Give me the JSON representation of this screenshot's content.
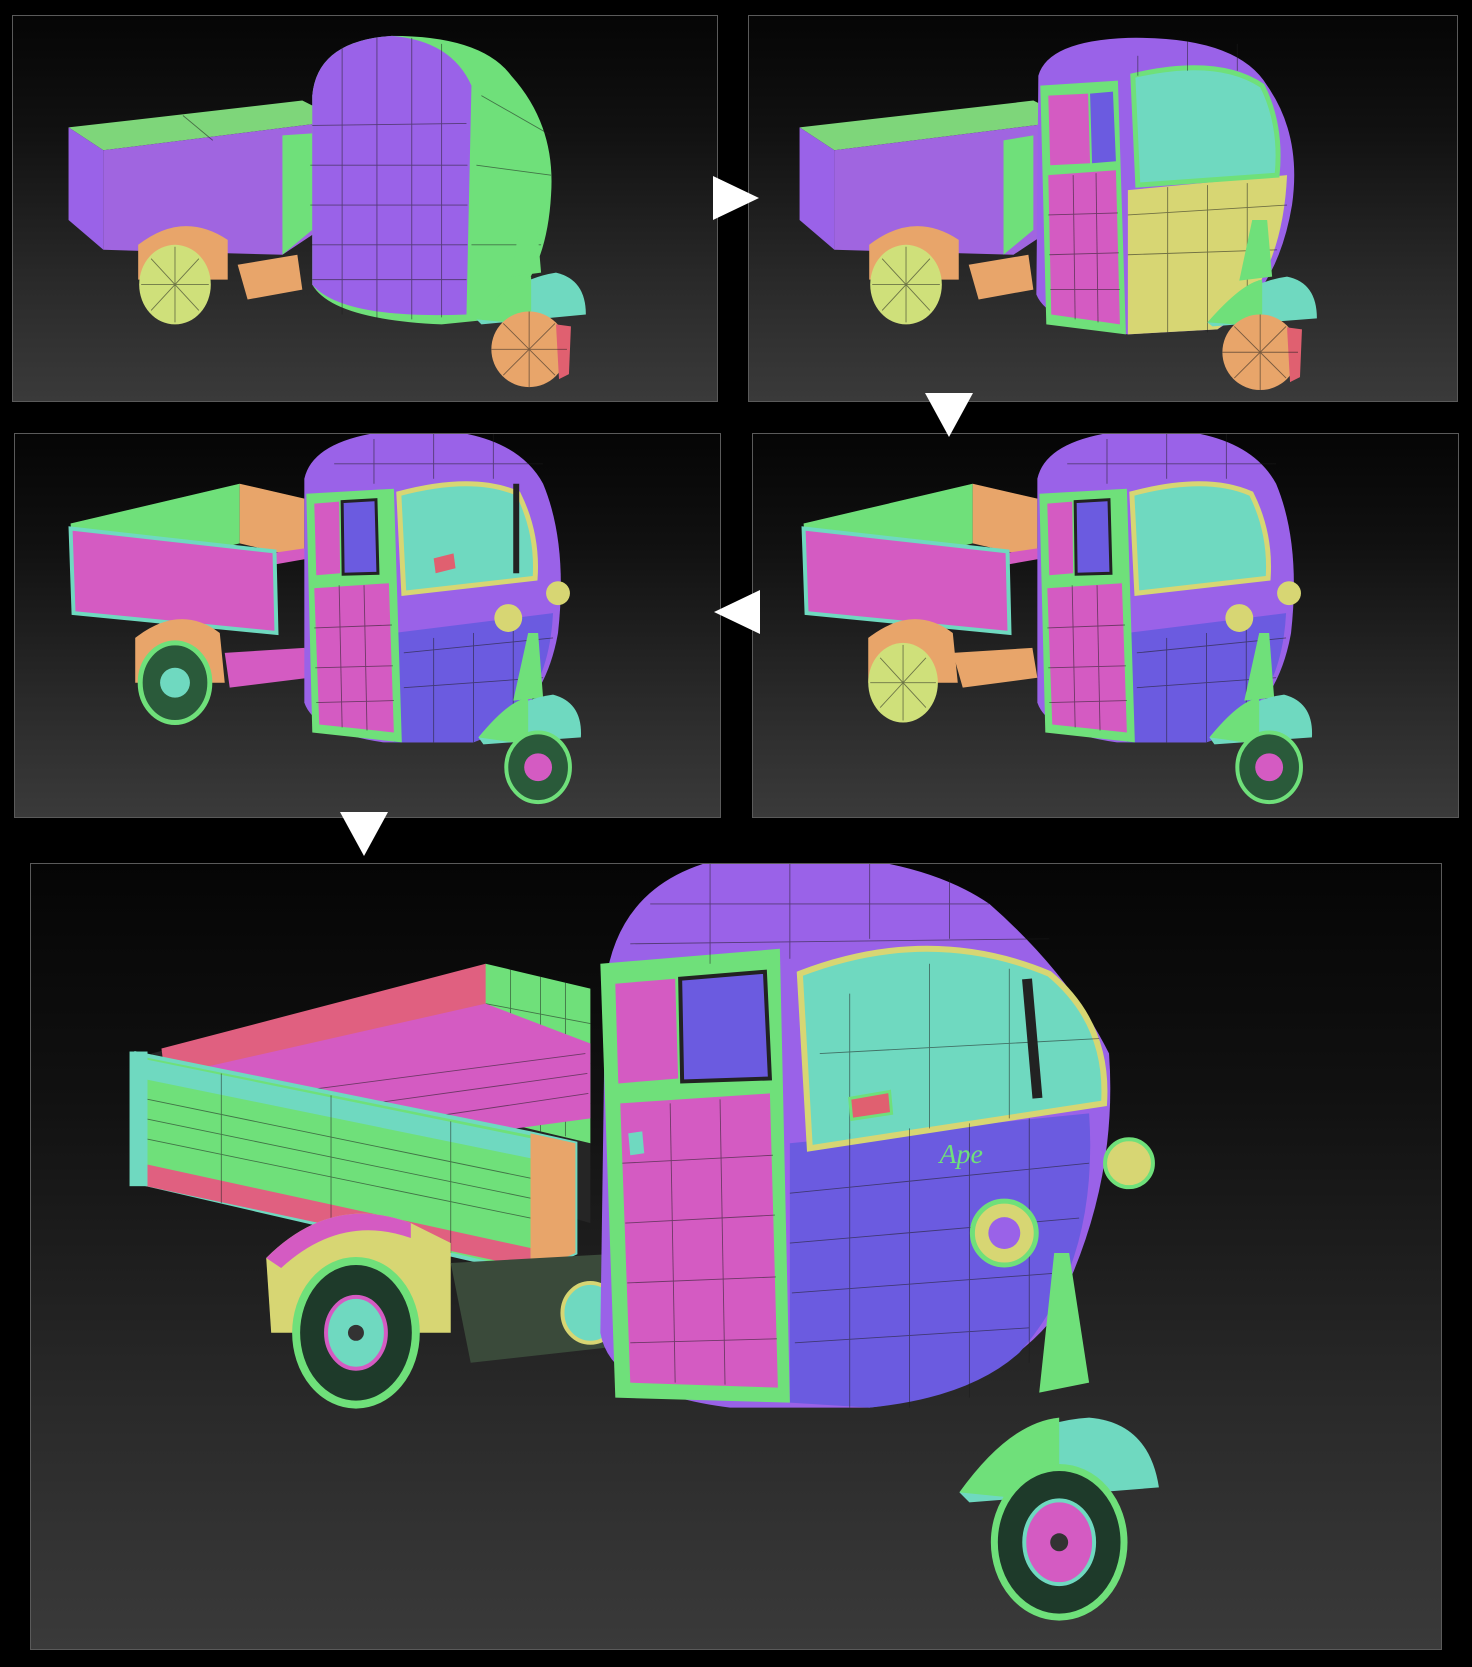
{
  "figure": {
    "stages": [
      {
        "id": "stage-1",
        "description_label": ""
      },
      {
        "id": "stage-2",
        "description_label": ""
      },
      {
        "id": "stage-3",
        "description_label": ""
      },
      {
        "id": "stage-4",
        "description_label": ""
      },
      {
        "id": "stage-final",
        "description_label": ""
      }
    ],
    "arrows": [
      "right",
      "down",
      "left",
      "down"
    ],
    "decal_text": "Ape",
    "colors": {
      "background": "#000000",
      "panel_border": "#5a5a5a",
      "purple": "#9a62e8",
      "green": "#6fe07a",
      "pink": "#d45bc2",
      "cyan": "#6fd9c0",
      "yellow": "#d7d673",
      "orange": "#e8a56a",
      "blue": "#6b5be0",
      "arrow": "#ffffff"
    }
  }
}
